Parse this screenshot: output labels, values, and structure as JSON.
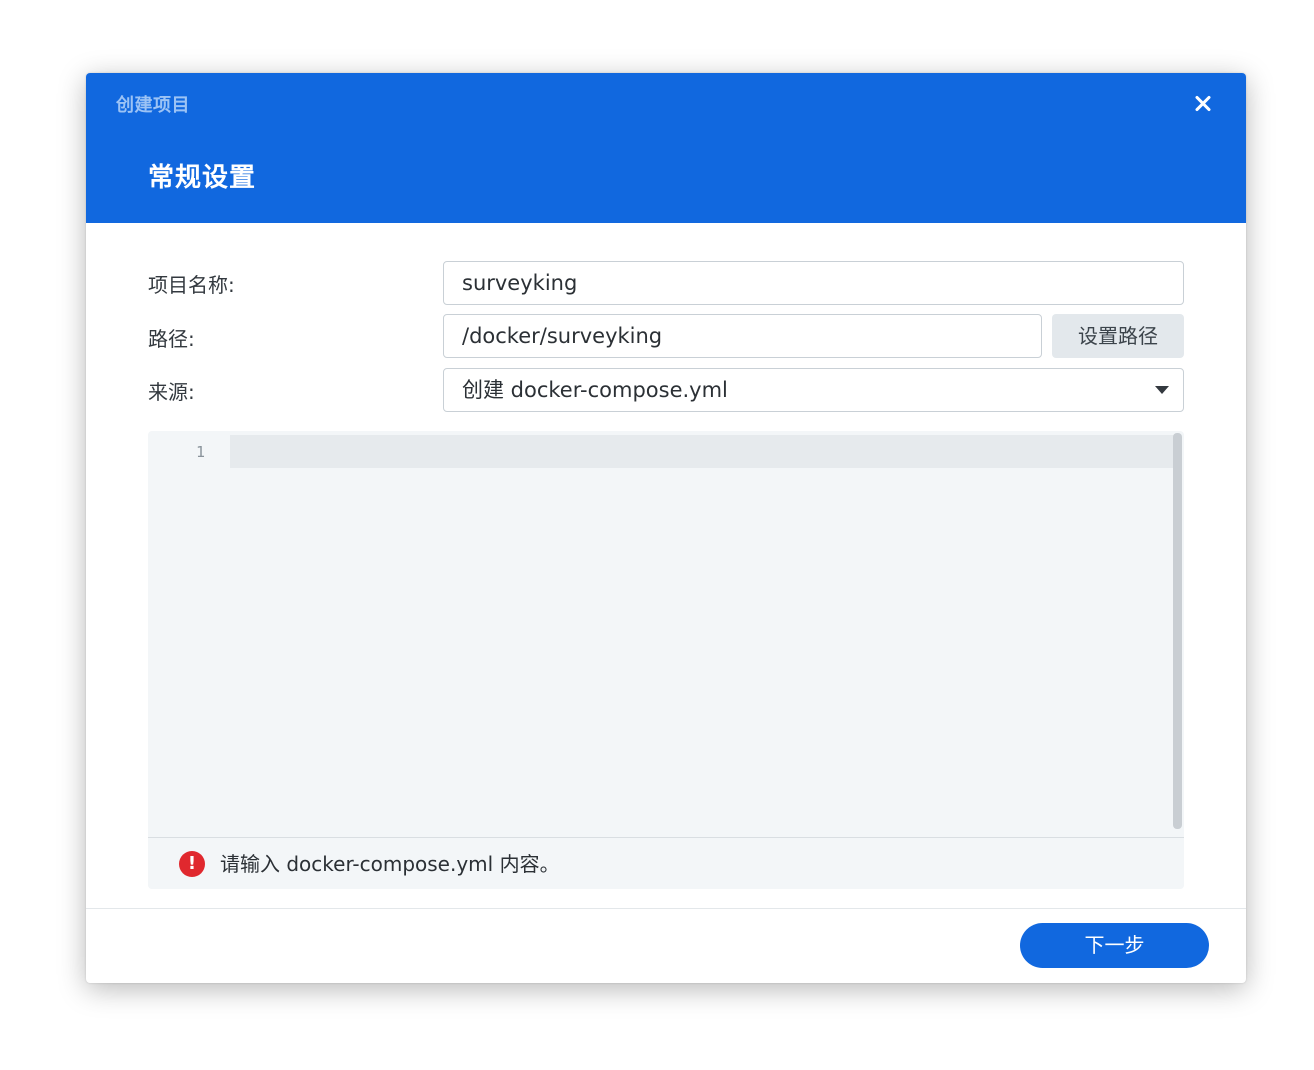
{
  "dialog": {
    "window_title": "创建项目",
    "step_title": "常规设置",
    "close_icon": "close-icon"
  },
  "form": {
    "project_name": {
      "label": "项目名称:",
      "value": "surveyking"
    },
    "path": {
      "label": "路径:",
      "value": "/docker/surveyking",
      "button_label": "设置路径"
    },
    "source": {
      "label": "来源:",
      "selected": "创建 docker-compose.yml",
      "icon": "chevron-down-icon"
    }
  },
  "editor": {
    "line_numbers": [
      "1"
    ],
    "content": "",
    "error_icon": "error-icon",
    "error_icon_glyph": "!",
    "error_message": "请输入 docker-compose.yml 内容。"
  },
  "footer": {
    "next_label": "下一步"
  },
  "colors": {
    "accent": "#1168df",
    "error": "#e0282e"
  }
}
